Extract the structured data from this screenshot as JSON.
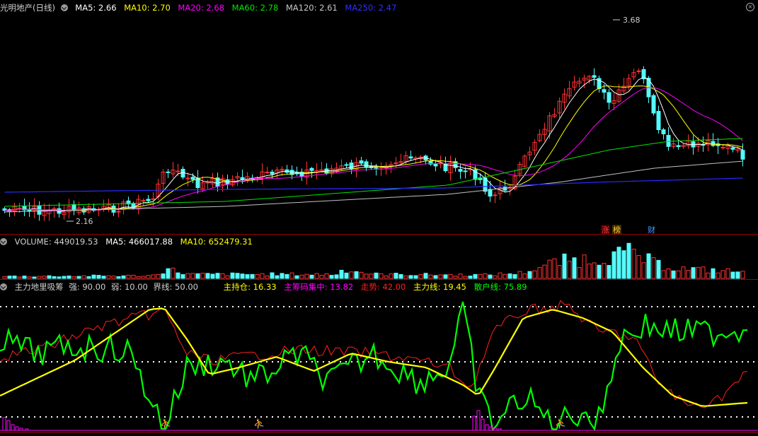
{
  "colors": {
    "up": "#ff3232",
    "down": "#54fcfc",
    "ma5": "#ffffff",
    "ma10": "#ffff00",
    "ma20": "#ff00ff",
    "ma60": "#00e600",
    "ma120": "#c0c0c0",
    "ma250": "#2a2aff",
    "main_line": "#ffff00",
    "retail_line": "#00ff00",
    "trend_line": "#ff2020"
  },
  "price_panel": {
    "stock_name": "光明地产(日线)",
    "ma5": "MA5: 2.66",
    "ma10": "MA10: 2.70",
    "ma20": "MA20: 2.68",
    "ma60": "MA60: 2.78",
    "ma120": "MA120: 2.61",
    "ma250": "MA250: 2.47",
    "high_label": "3.68",
    "low_label": "2.16",
    "badge_up": "涨",
    "badge_bang": "榜",
    "badge_cai": "财"
  },
  "volume_panel": {
    "title": "VOLUME: 449019.53",
    "ma5": "MA5: 466017.88",
    "ma10": "MA10: 652479.31"
  },
  "indicator_panel": {
    "title": "主力地里吸筹",
    "strong": "强: 90.00",
    "weak": "弱: 10.00",
    "boundary": "界线: 50.00",
    "holding": "主持仓: 16.33",
    "concentration": "主筹码集中: 13.82",
    "trend": "走势: 42.00",
    "main_line": "主力线: 19.45",
    "retail_line": "散户线: 75.89"
  }
}
